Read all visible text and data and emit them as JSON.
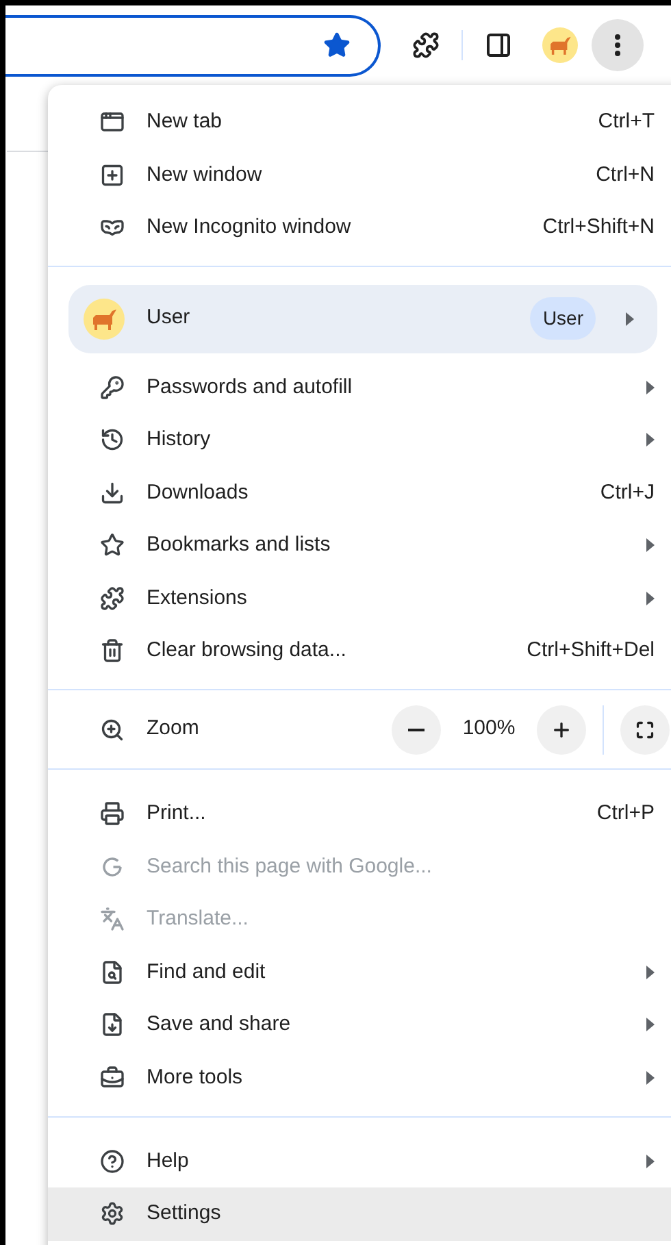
{
  "toolbar": {
    "bookmarked": true,
    "menu_open": true
  },
  "menu": {
    "sections": [
      {
        "kind": "items",
        "items": [
          {
            "label": "New tab",
            "shortcut": "Ctrl+T",
            "submenu": false,
            "disabled": false,
            "highlighted": false
          },
          {
            "label": "New window",
            "shortcut": "Ctrl+N",
            "submenu": false,
            "disabled": false,
            "highlighted": false
          },
          {
            "label": "New Incognito window",
            "shortcut": "Ctrl+Shift+N",
            "submenu": false,
            "disabled": false,
            "highlighted": false
          }
        ]
      },
      {
        "kind": "profile",
        "profile": {
          "name": "User",
          "badge": "User",
          "submenu": true
        },
        "items": [
          {
            "label": "Passwords and autofill",
            "submenu": true,
            "disabled": false,
            "highlighted": false
          },
          {
            "label": "History",
            "submenu": true,
            "disabled": false,
            "highlighted": false
          },
          {
            "label": "Downloads",
            "shortcut": "Ctrl+J",
            "submenu": false,
            "disabled": false,
            "highlighted": false
          },
          {
            "label": "Bookmarks and lists",
            "submenu": true,
            "disabled": false,
            "highlighted": false
          },
          {
            "label": "Extensions",
            "submenu": true,
            "disabled": false,
            "highlighted": false
          },
          {
            "label": "Clear browsing data...",
            "shortcut": "Ctrl+Shift+Del",
            "submenu": false,
            "disabled": false,
            "highlighted": false
          }
        ]
      },
      {
        "kind": "zoom",
        "label": "Zoom",
        "value": "100%"
      },
      {
        "kind": "items",
        "items": [
          {
            "label": "Print...",
            "shortcut": "Ctrl+P",
            "submenu": false,
            "disabled": false,
            "highlighted": false
          },
          {
            "label": "Search this page with Google...",
            "submenu": false,
            "disabled": true,
            "highlighted": false
          },
          {
            "label": "Translate...",
            "submenu": false,
            "disabled": true,
            "highlighted": false
          },
          {
            "label": "Find and edit",
            "submenu": true,
            "disabled": false,
            "highlighted": false
          },
          {
            "label": "Save and share",
            "submenu": true,
            "disabled": false,
            "highlighted": false
          },
          {
            "label": "More tools",
            "submenu": true,
            "disabled": false,
            "highlighted": false
          }
        ]
      },
      {
        "kind": "items",
        "items": [
          {
            "label": "Help",
            "submenu": true,
            "disabled": false,
            "highlighted": false
          },
          {
            "label": "Settings",
            "submenu": false,
            "disabled": false,
            "highlighted": true
          }
        ]
      }
    ]
  }
}
